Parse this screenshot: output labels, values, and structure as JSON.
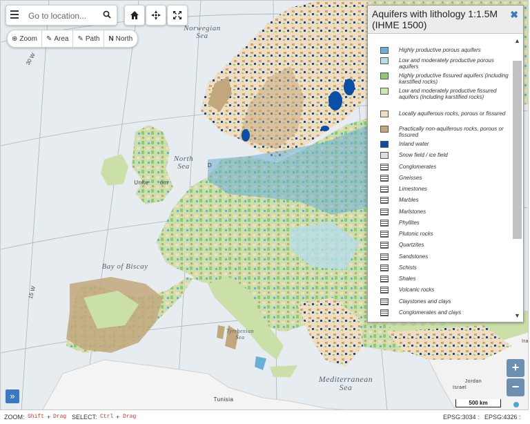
{
  "search": {
    "placeholder": "Go to location..."
  },
  "toolbar": {
    "home_icon": "home-icon",
    "locate_icon": "crosshair-icon",
    "fullscreen_icon": "fullscreen-icon",
    "tools": [
      "Zoom",
      "Area",
      "Path",
      "North"
    ]
  },
  "map_labels": {
    "norwegian_sea": "Norwegian\nSea",
    "north_sea": "North\nSea",
    "bay_of_biscay": "Bay of Biscay",
    "tyrrhenian_sea": "Tyrrhenian\nSea",
    "mediterranean_sea": "Mediterranean\nSea",
    "united_kingdom_partial": "Unite      om",
    "tunisia": "Tunisia",
    "israel": "Israel",
    "jordan": "Jordan",
    "iraq_partial": "Ira",
    "d_partial": "D"
  },
  "graticule": {
    "w30": "30 W",
    "w15": "15 W"
  },
  "legend": {
    "title": "Aquifers with lithology 1:1.5M (IHME 1500)",
    "close_icon": "close-icon",
    "items": [
      {
        "label": "Highly productive porous aquifers",
        "color": "#6baed6",
        "kind": "fill"
      },
      {
        "label": "Low and moderately productive porous aquifers",
        "color": "#b6dde8",
        "kind": "fill"
      },
      {
        "label": "Highly productive fissured aquifers (including karstified rocks)",
        "color": "#8fc978",
        "kind": "fill"
      },
      {
        "label": "Low and moderately productive fissured aquifers (including karstified rocks)",
        "color": "#cbe8b5",
        "kind": "fill"
      },
      {
        "label": "Locally aquiferous rocks, porous or fissured",
        "color": "#f4dcbf",
        "kind": "fill"
      },
      {
        "label": "Practically non-aquiferous rocks, porous or fissured",
        "color": "#c2a77c",
        "kind": "fill"
      },
      {
        "label": "Inland water",
        "color": "#0b4ea6",
        "kind": "fill"
      },
      {
        "label": "Snow field / ice field",
        "color": "#dddddd",
        "kind": "fill"
      },
      {
        "label": "Conglomerates",
        "color": "#ffffff",
        "kind": "hatch"
      },
      {
        "label": "Gneisses",
        "color": "#ffffff",
        "kind": "hatch"
      },
      {
        "label": "Limestones",
        "color": "#ffffff",
        "kind": "hatch"
      },
      {
        "label": "Marbles",
        "color": "#ffffff",
        "kind": "hatch"
      },
      {
        "label": "Marlstones",
        "color": "#ffffff",
        "kind": "hatch"
      },
      {
        "label": "Phyllites",
        "color": "#ffffff",
        "kind": "hatch"
      },
      {
        "label": "Plutonic rocks",
        "color": "#ffffff",
        "kind": "hatch"
      },
      {
        "label": "Quartzites",
        "color": "#ffffff",
        "kind": "hatch"
      },
      {
        "label": "Sandstones",
        "color": "#ffffff",
        "kind": "hatch"
      },
      {
        "label": "Schists",
        "color": "#ffffff",
        "kind": "hatch"
      },
      {
        "label": "Shales",
        "color": "#ffffff",
        "kind": "hatch"
      },
      {
        "label": "Volcanic rocks",
        "color": "#ffffff",
        "kind": "hatch"
      },
      {
        "label": "Claystones and clays",
        "color": "#ffffff",
        "kind": "hatch"
      },
      {
        "label": "Conglomerates and clays",
        "color": "#ffffff",
        "kind": "hatch"
      }
    ]
  },
  "zoom": {
    "in": "+",
    "out": "−"
  },
  "expand_label": "»",
  "scale_label": "500 km",
  "status": {
    "zoom_label": "ZOOM:",
    "zoom_keys": [
      "Shift",
      "+",
      "Drag"
    ],
    "select_label": "SELECT:",
    "select_keys": [
      "Ctrl",
      "+",
      "Drag"
    ],
    "epsg3034": "EPSG:3034 :",
    "epsg4326": "EPSG:4326 :"
  }
}
